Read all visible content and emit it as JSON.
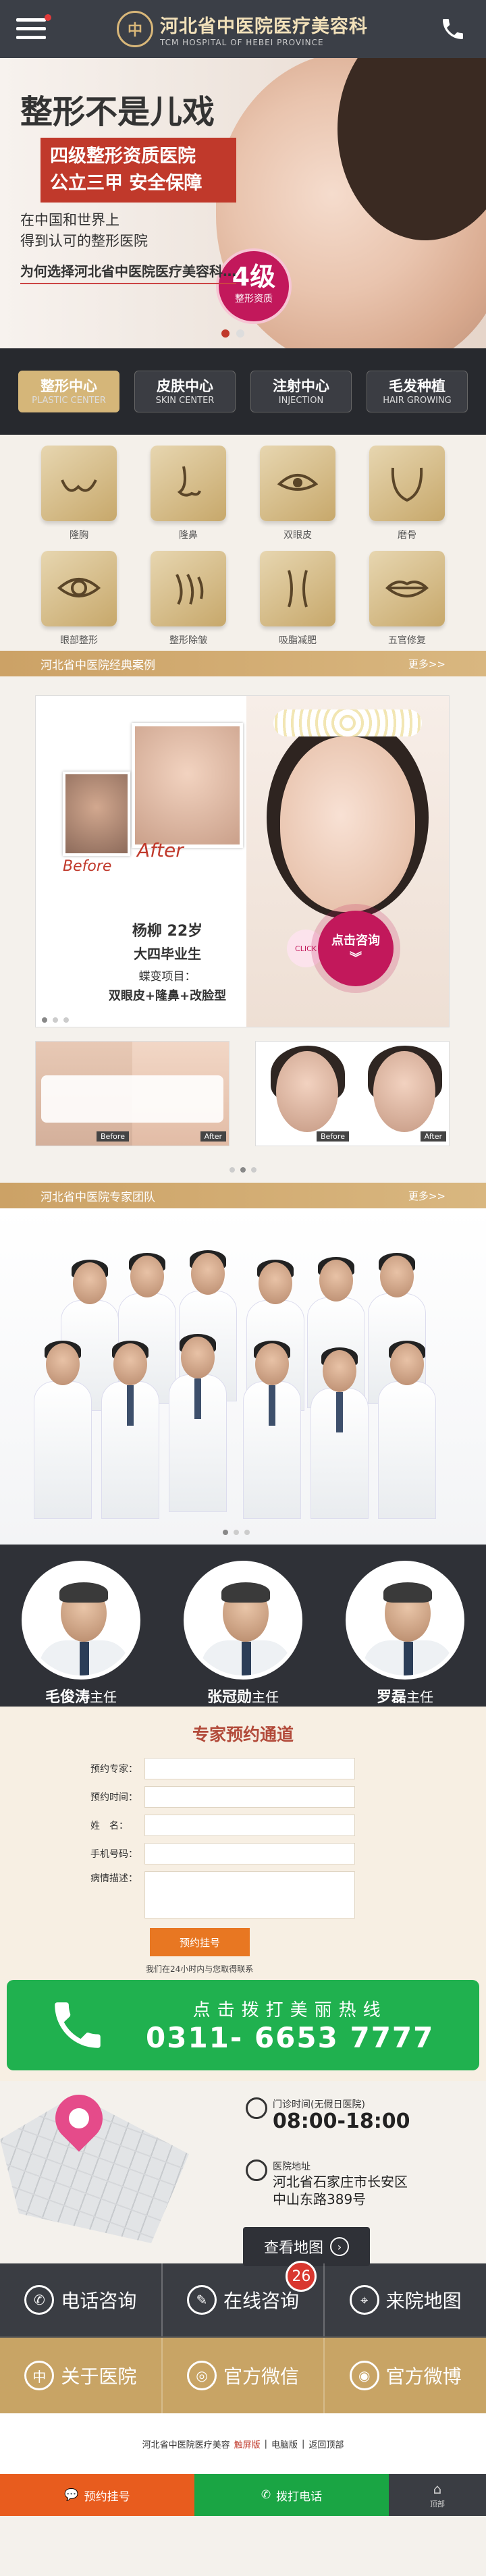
{
  "header": {
    "logo_emblem": "中",
    "title": "河北省中医院医疗美容科",
    "subtitle": "TCM HOSPITAL OF HEBEI PROVINCE",
    "phone_icon": "phone-icon",
    "menu_icon": "menu-icon"
  },
  "banner": {
    "title": "整形不是儿戏",
    "tag_lines": [
      "四级整形资质医院",
      "公立三甲 安全保障"
    ],
    "sub_lines": [
      "在中国和世界上",
      "得到认可的整形医院"
    ],
    "bottom_text": "为何选择河北省中医院医疗美容科…",
    "badge_number": "4级",
    "badge_text": "整形资质"
  },
  "centers": [
    {
      "cn": "整形中心",
      "en": "PLASTIC CENTER",
      "active": true
    },
    {
      "cn": "皮肤中心",
      "en": "SKIN CENTER",
      "active": false
    },
    {
      "cn": "注射中心",
      "en": "INJECTION",
      "active": false
    },
    {
      "cn": "毛发种植",
      "en": "HAIR GROWING",
      "active": false
    }
  ],
  "grid": [
    {
      "label": "隆胸",
      "icon": "breast-icon"
    },
    {
      "label": "隆鼻",
      "icon": "nose-icon"
    },
    {
      "label": "双眼皮",
      "icon": "eyelid-icon"
    },
    {
      "label": "磨骨",
      "icon": "jaw-icon"
    },
    {
      "label": "眼部整形",
      "icon": "eye-icon"
    },
    {
      "label": "整形除皱",
      "icon": "wrinkle-icon"
    },
    {
      "label": "吸脂减肥",
      "icon": "liposuction-icon"
    },
    {
      "label": "五官修复",
      "icon": "lips-icon"
    }
  ],
  "cases_bar": {
    "title": "河北省中医院经典案例",
    "more": "更多>>"
  },
  "case_main": {
    "before": "Before",
    "after": "After",
    "name": "杨柳 22岁",
    "edu": "大四毕业生",
    "project_label": "蝶变项目：",
    "projects": "双眼皮+隆鼻+改脸型",
    "click": "CLICK",
    "consult": "点击咨询"
  },
  "small_cases": [
    {
      "before": "Before",
      "after": "After"
    },
    {
      "before": "Before",
      "after": "After"
    }
  ],
  "team_bar": {
    "title": "河北省中医院专家团队",
    "more": "更多>>"
  },
  "experts": [
    {
      "name": "毛俊涛",
      "title": "主任"
    },
    {
      "name": "张冠勋",
      "title": "主任"
    },
    {
      "name": "罗磊",
      "title": "主任"
    }
  ],
  "booking": {
    "title": "专家预约通道",
    "fields": [
      {
        "label": "预约专家："
      },
      {
        "label": "预约时间："
      },
      {
        "label": "姓　名："
      },
      {
        "label": "手机号码："
      }
    ],
    "ta_label": "病情描述：",
    "submit": "预约挂号",
    "note": "我们在24小时内与您取得联系"
  },
  "hotline": {
    "top": "点击拨打美丽热线",
    "number": "0311- 6653 7777"
  },
  "address": {
    "hours_label": "门诊时间(无假日医院)",
    "hours": "08:00-18:00",
    "addr_label": "医院地址",
    "addr_lines": [
      "河北省石家庄市长安区",
      "中山东路389号"
    ],
    "map_button": "查看地图"
  },
  "links": [
    {
      "label": "电话咨询",
      "icon": "phone-icon"
    },
    {
      "label": "在线咨询",
      "icon": "chat-icon",
      "badge": "26"
    },
    {
      "label": "来院地图",
      "icon": "map-pin-icon"
    },
    {
      "label": "关于医院",
      "icon": "hospital-icon"
    },
    {
      "label": "官方微信",
      "icon": "wechat-icon"
    },
    {
      "label": "官方微博",
      "icon": "weibo-icon"
    }
  ],
  "footer": {
    "name": "河北省中医院医疗美容",
    "touch": "触屏版",
    "sep1": "|",
    "pc": "电脑版",
    "sep2": "|",
    "top": "返回顶部"
  },
  "bottom_bar": {
    "chat": "预约挂号",
    "call": "拨打电话",
    "top": "顶部"
  }
}
